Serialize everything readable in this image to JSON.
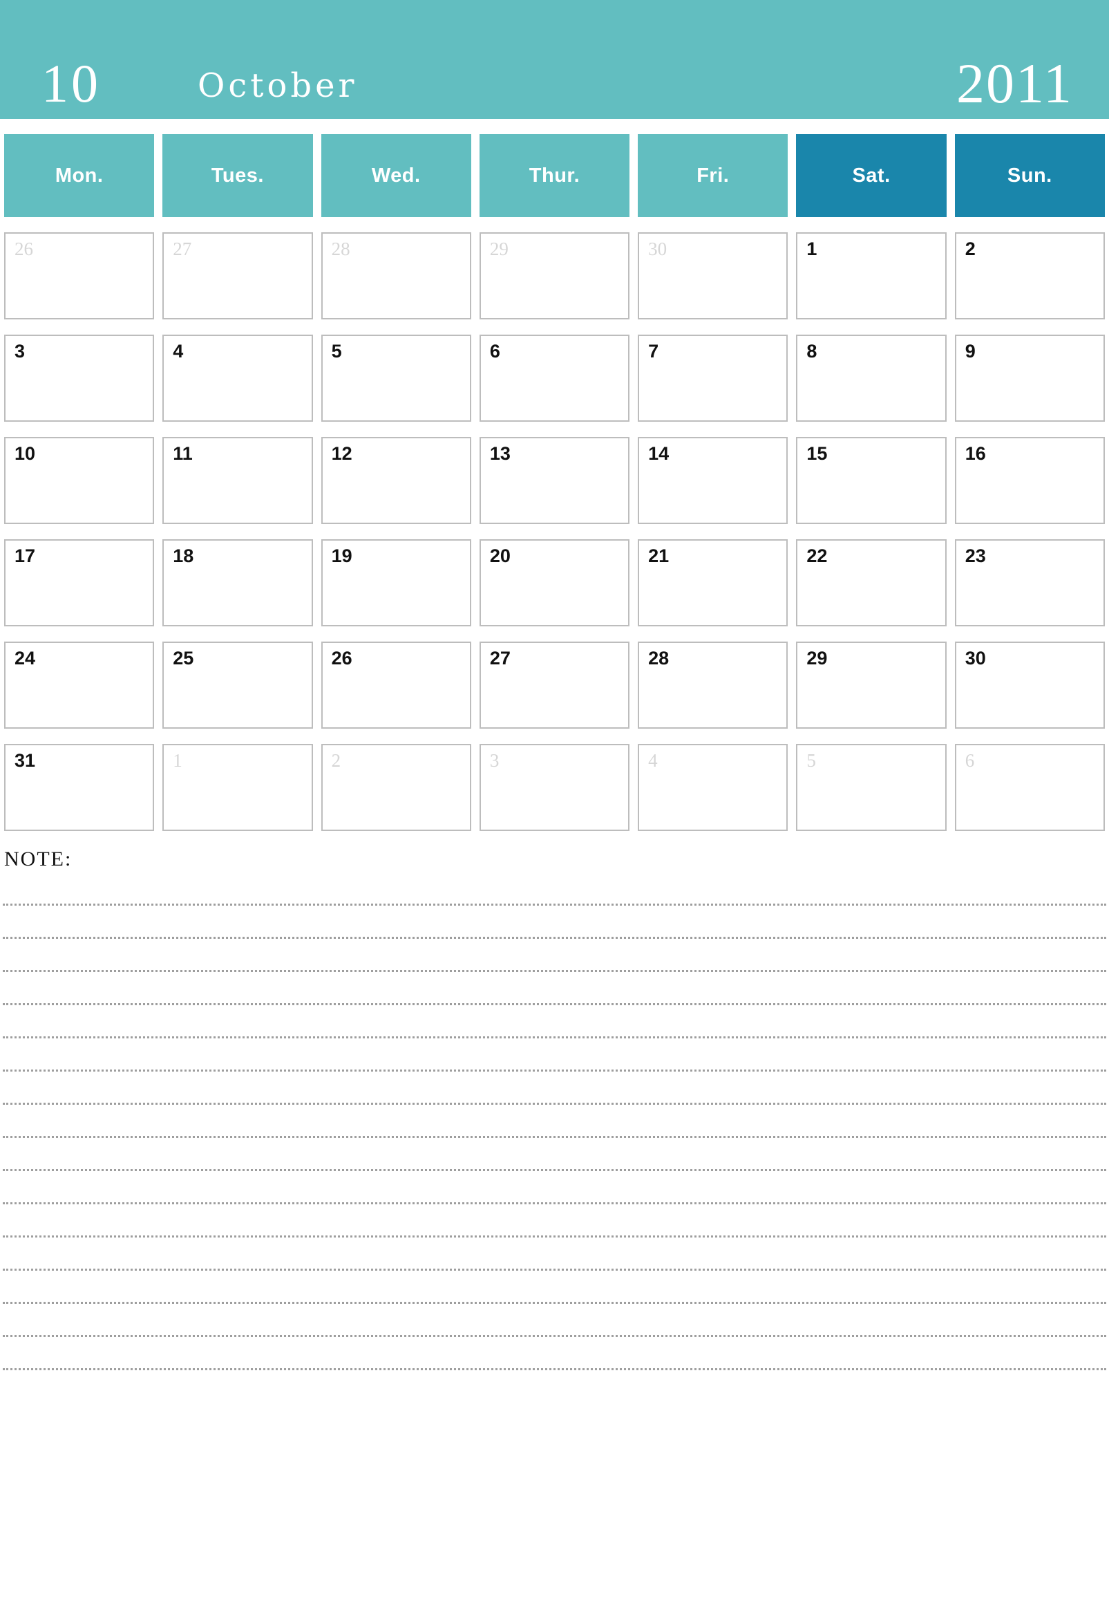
{
  "header": {
    "month_number": "10",
    "month_name": "October",
    "year": "2011",
    "banner_color": "#62BEC0"
  },
  "weekdays": [
    {
      "label": "Mon.",
      "weekend": false,
      "color": "#62BEC0"
    },
    {
      "label": "Tues.",
      "weekend": false,
      "color": "#62BEC0"
    },
    {
      "label": "Wed.",
      "weekend": false,
      "color": "#62BEC0"
    },
    {
      "label": "Thur.",
      "weekend": false,
      "color": "#62BEC0"
    },
    {
      "label": "Fri.",
      "weekend": false,
      "color": "#62BEC0"
    },
    {
      "label": "Sat.",
      "weekend": true,
      "color": "#1A86AB"
    },
    {
      "label": "Sun.",
      "weekend": true,
      "color": "#1A86AB"
    }
  ],
  "weeks": [
    [
      {
        "day": "26",
        "current_month": false
      },
      {
        "day": "27",
        "current_month": false
      },
      {
        "day": "28",
        "current_month": false
      },
      {
        "day": "29",
        "current_month": false
      },
      {
        "day": "30",
        "current_month": false
      },
      {
        "day": "1",
        "current_month": true
      },
      {
        "day": "2",
        "current_month": true
      }
    ],
    [
      {
        "day": "3",
        "current_month": true
      },
      {
        "day": "4",
        "current_month": true
      },
      {
        "day": "5",
        "current_month": true
      },
      {
        "day": "6",
        "current_month": true
      },
      {
        "day": "7",
        "current_month": true
      },
      {
        "day": "8",
        "current_month": true
      },
      {
        "day": "9",
        "current_month": true
      }
    ],
    [
      {
        "day": "10",
        "current_month": true
      },
      {
        "day": "11",
        "current_month": true
      },
      {
        "day": "12",
        "current_month": true
      },
      {
        "day": "13",
        "current_month": true
      },
      {
        "day": "14",
        "current_month": true
      },
      {
        "day": "15",
        "current_month": true
      },
      {
        "day": "16",
        "current_month": true
      }
    ],
    [
      {
        "day": "17",
        "current_month": true
      },
      {
        "day": "18",
        "current_month": true
      },
      {
        "day": "19",
        "current_month": true
      },
      {
        "day": "20",
        "current_month": true
      },
      {
        "day": "21",
        "current_month": true
      },
      {
        "day": "22",
        "current_month": true
      },
      {
        "day": "23",
        "current_month": true
      }
    ],
    [
      {
        "day": "24",
        "current_month": true
      },
      {
        "day": "25",
        "current_month": true
      },
      {
        "day": "26",
        "current_month": true
      },
      {
        "day": "27",
        "current_month": true
      },
      {
        "day": "28",
        "current_month": true
      },
      {
        "day": "29",
        "current_month": true
      },
      {
        "day": "30",
        "current_month": true
      }
    ],
    [
      {
        "day": "31",
        "current_month": true
      },
      {
        "day": "1",
        "current_month": false
      },
      {
        "day": "2",
        "current_month": false
      },
      {
        "day": "3",
        "current_month": false
      },
      {
        "day": "4",
        "current_month": false
      },
      {
        "day": "5",
        "current_month": false
      },
      {
        "day": "6",
        "current_month": false
      }
    ]
  ],
  "note": {
    "label": "NOTE:",
    "line_count": 15,
    "line_color": "#9E9E9E"
  },
  "colors": {
    "teal": "#62BEC0",
    "blue": "#1A86AB",
    "cell_border": "#BDBDBD",
    "adjacent_day_text": "#D6D6D6",
    "day_text": "#111111"
  }
}
